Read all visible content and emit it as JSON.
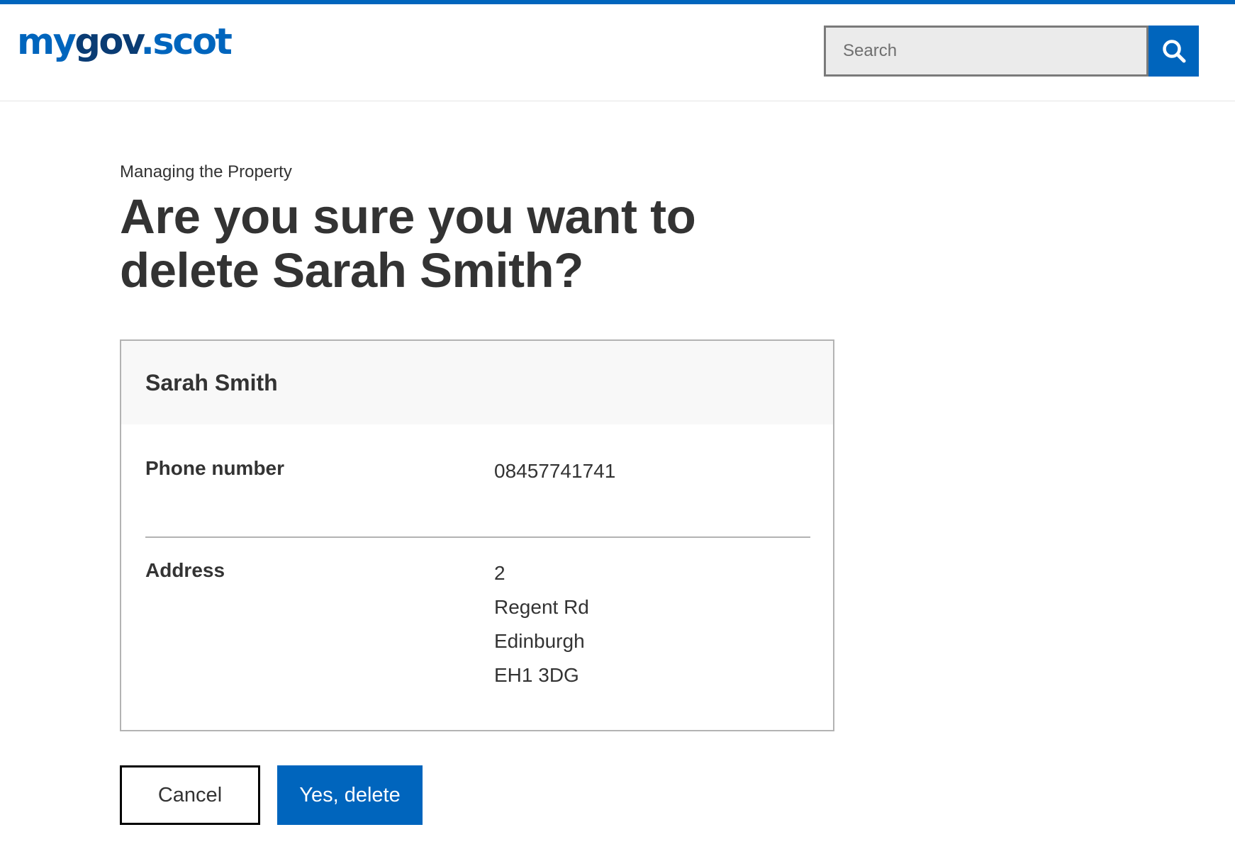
{
  "brand": {
    "logo_my": "my",
    "logo_gov": "gov",
    "logo_scot": ".scot",
    "accent_color": "#0065bd",
    "dark_color": "#0a3c74"
  },
  "search": {
    "placeholder": "Search",
    "value": "",
    "button_icon": "search-icon"
  },
  "page": {
    "caption": "Managing the Property",
    "title": "Are you sure you want to delete Sarah Smith?"
  },
  "summary": {
    "title": "Sarah Smith",
    "rows": [
      {
        "key": "Phone number",
        "value": [
          "08457741741"
        ]
      },
      {
        "key": "Address",
        "value": [
          "2",
          "Regent Rd",
          "Edinburgh",
          "EH1 3DG"
        ]
      }
    ]
  },
  "actions": {
    "cancel_label": "Cancel",
    "confirm_label": "Yes, delete"
  }
}
